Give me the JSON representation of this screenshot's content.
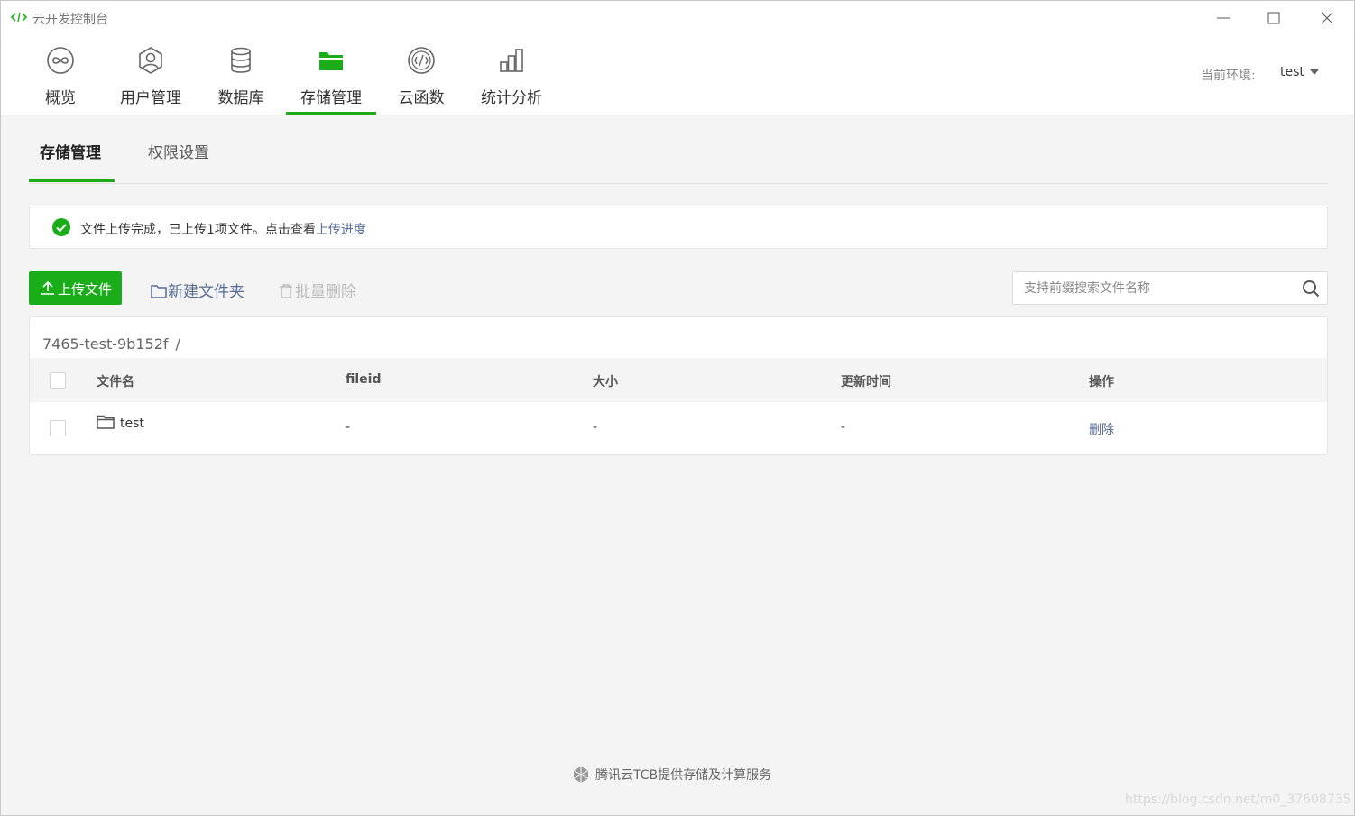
{
  "window": {
    "title": "云开发控制台"
  },
  "nav": {
    "items": [
      {
        "label": "概览",
        "icon": "infinity-icon",
        "active": false
      },
      {
        "label": "用户管理",
        "icon": "user-icon",
        "active": false
      },
      {
        "label": "数据库",
        "icon": "database-icon",
        "active": false
      },
      {
        "label": "存储管理",
        "icon": "folder-icon",
        "active": true
      },
      {
        "label": "云函数",
        "icon": "function-icon",
        "active": false
      },
      {
        "label": "统计分析",
        "icon": "bar-chart-icon",
        "active": false
      }
    ],
    "env_label": "当前环境:",
    "env_value": "test"
  },
  "subtabs": [
    "存储管理",
    "权限设置"
  ],
  "notice": {
    "message": "文件上传完成，已上传1项文件。点击查看",
    "link": "上传进度"
  },
  "toolbar": {
    "upload_label": "上传文件",
    "new_folder_label": "新建文件夹",
    "batch_delete_label": "批量删除"
  },
  "search": {
    "placeholder": "支持前缀搜索文件名称"
  },
  "table": {
    "breadcrumb": "7465-test-9b152f",
    "breadcrumb_sep": "/",
    "columns": [
      "文件名",
      "fileid",
      "大小",
      "更新时间",
      "操作"
    ],
    "rows": [
      {
        "name": "test",
        "fileid": "-",
        "size": "-",
        "updated": "-",
        "action": "删除"
      }
    ]
  },
  "footer": {
    "text": "腾讯云TCB提供存储及计算服务"
  },
  "watermark": "https://blog.csdn.net/m0_37608735",
  "colors": {
    "accent": "#1aad19",
    "link": "#576b95"
  }
}
